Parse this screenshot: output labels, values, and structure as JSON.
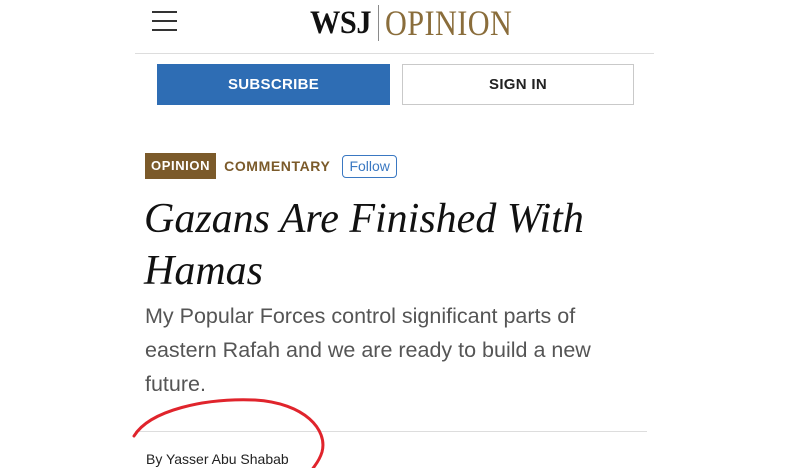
{
  "header": {
    "menu_icon": "hamburger-menu-icon",
    "logo_wsj": "WSJ",
    "logo_section": "OPINION",
    "subscribe_label": "SUBSCRIBE",
    "signin_label": "SIGN IN"
  },
  "article": {
    "section_badge": "OPINION",
    "category": "COMMENTARY",
    "follow_label": "Follow",
    "headline": "Gazans Are Finished With Hamas",
    "dek": "My Popular Forces control significant parts of eastern Rafah and we are ready to build a new future.",
    "byline": "By Yasser Abu Shabab"
  },
  "colors": {
    "subscribe_bg": "#2e6db4",
    "opinion_badge_bg": "#7b5a2a",
    "opinion_logo": "#8a6d3b",
    "follow_accent": "#3a78c2",
    "annotation_circle": "#e0242c"
  }
}
